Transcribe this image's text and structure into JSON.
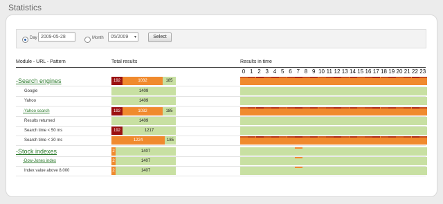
{
  "page": {
    "title": "Statistics"
  },
  "filter": {
    "day_label": "Day",
    "day_value": "2009-05-28",
    "month_label": "Month",
    "month_value": "05/2009",
    "select_label": "Select",
    "selected_mode": "Day"
  },
  "table": {
    "col_module": "Module - URL - Pattern",
    "col_total": "Total results",
    "col_time": "Results in time",
    "hours": [
      "0",
      "1",
      "2",
      "3",
      "4",
      "5",
      "6",
      "7",
      "8",
      "9",
      "10",
      "11",
      "12",
      "13",
      "14",
      "15",
      "16",
      "17",
      "18",
      "19",
      "20",
      "21",
      "22",
      "23"
    ]
  },
  "rows": [
    {
      "label": "-Search engines",
      "level": 1,
      "dark": "192",
      "orange": "1032",
      "green": "185",
      "timeline": "orange"
    },
    {
      "label": "Google",
      "level": 3,
      "dark": "",
      "orange": "",
      "green": "1409",
      "timeline": "green"
    },
    {
      "label": "Yahoo",
      "level": 3,
      "dark": "",
      "orange": "",
      "green": "1409",
      "timeline": "green"
    },
    {
      "label": "-Yahoo search",
      "level": 2,
      "dark": "192",
      "orange": "1032",
      "green": "185",
      "timeline": "orange"
    },
    {
      "label": "Results returned",
      "level": 3,
      "dark": "",
      "orange": "",
      "green": "1409",
      "timeline": "green"
    },
    {
      "label": "Search time < 50 ms",
      "level": 3,
      "dark": "192",
      "orange": "",
      "green": "1217",
      "timeline": "green"
    },
    {
      "label": "Search time < 30 ms",
      "level": 3,
      "dark": "",
      "orange": "1224",
      "green": "185",
      "timeline": "orange"
    },
    {
      "label": "-Stock indexes",
      "level": 1,
      "dark": "",
      "orange": "2",
      "green": "1407",
      "timeline": "green"
    },
    {
      "label": "-Dow-Jones index",
      "level": 2,
      "dark": "",
      "orange": "2",
      "green": "1407",
      "timeline": "green"
    },
    {
      "label": "Index value above 8.000",
      "level": 3,
      "dark": "",
      "orange": "2",
      "green": "1407",
      "timeline": "green"
    }
  ],
  "colors": {
    "dark_red": "#9a1010",
    "orange": "#f08a2e",
    "green": "#c8e0a2",
    "link_green": "#2d7b2d"
  },
  "icons": {
    "dropdown": "chevron-down-icon"
  }
}
